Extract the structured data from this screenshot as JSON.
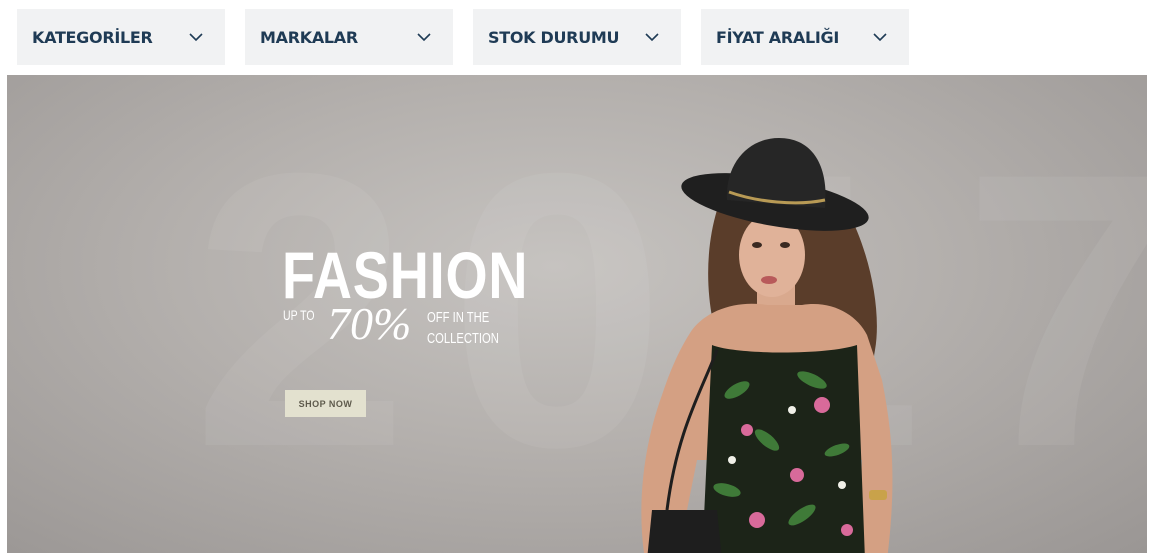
{
  "filters": [
    {
      "label": "KATEGORİLER",
      "icon": "chevron-down-icon"
    },
    {
      "label": "MARKALAR",
      "icon": "chevron-down-icon"
    },
    {
      "label": "STOK DURUMU",
      "icon": "chevron-down-icon"
    },
    {
      "label": "FİYAT ARALIĞI",
      "icon": "chevron-down-icon"
    }
  ],
  "banner": {
    "year": "2017",
    "headline": "FASHION",
    "upto": "UP TO",
    "percent": "70%",
    "off_line1": "OFF IN THE",
    "off_line2": "COLLECTION",
    "button": "SHOP NOW"
  },
  "colors": {
    "filter_bg": "#f1f2f3",
    "filter_text": "#1f3b55",
    "banner_bg": "#b4b0ad",
    "button_bg": "#e3e1cf"
  }
}
